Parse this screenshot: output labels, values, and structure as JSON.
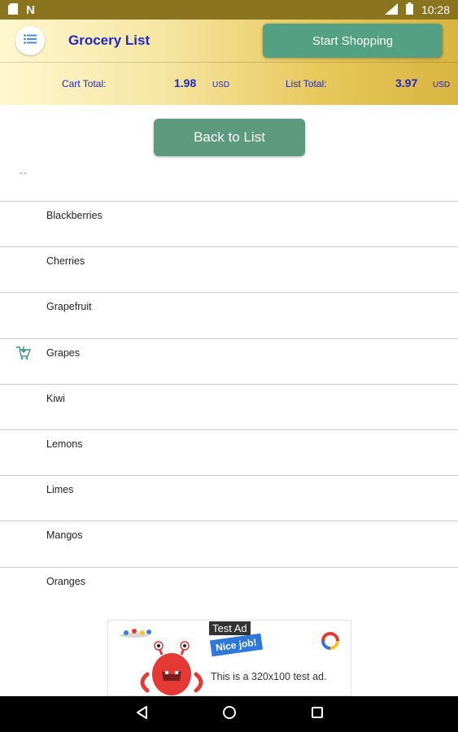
{
  "status_bar": {
    "time": "10:28",
    "network": "LTE"
  },
  "header": {
    "title": "Grocery List",
    "start_button": "Start Shopping",
    "cart_total_label": "Cart Total:",
    "cart_total_value": "1.98",
    "cart_total_unit": "USD",
    "list_total_label": "List Total:",
    "list_total_value": "3.97",
    "list_total_unit": "USD"
  },
  "back_button": "Back to List",
  "category_marker": "--",
  "items": [
    {
      "label": "Blackberries",
      "in_cart": false
    },
    {
      "label": "Cherries",
      "in_cart": false
    },
    {
      "label": "Grapefruit",
      "in_cart": false
    },
    {
      "label": "Grapes",
      "in_cart": true
    },
    {
      "label": "Kiwi",
      "in_cart": false
    },
    {
      "label": "Lemons",
      "in_cart": false
    },
    {
      "label": "Limes",
      "in_cart": false
    },
    {
      "label": "Mangos",
      "in_cart": false
    },
    {
      "label": "Oranges",
      "in_cart": false
    }
  ],
  "ad": {
    "tag": "Test Ad",
    "badge": "Nice job!",
    "text": "This is a 320x100 test ad."
  },
  "colors": {
    "title": "#1f28c8",
    "button": "#53a085",
    "cart_icon": "#3a8f8a"
  }
}
